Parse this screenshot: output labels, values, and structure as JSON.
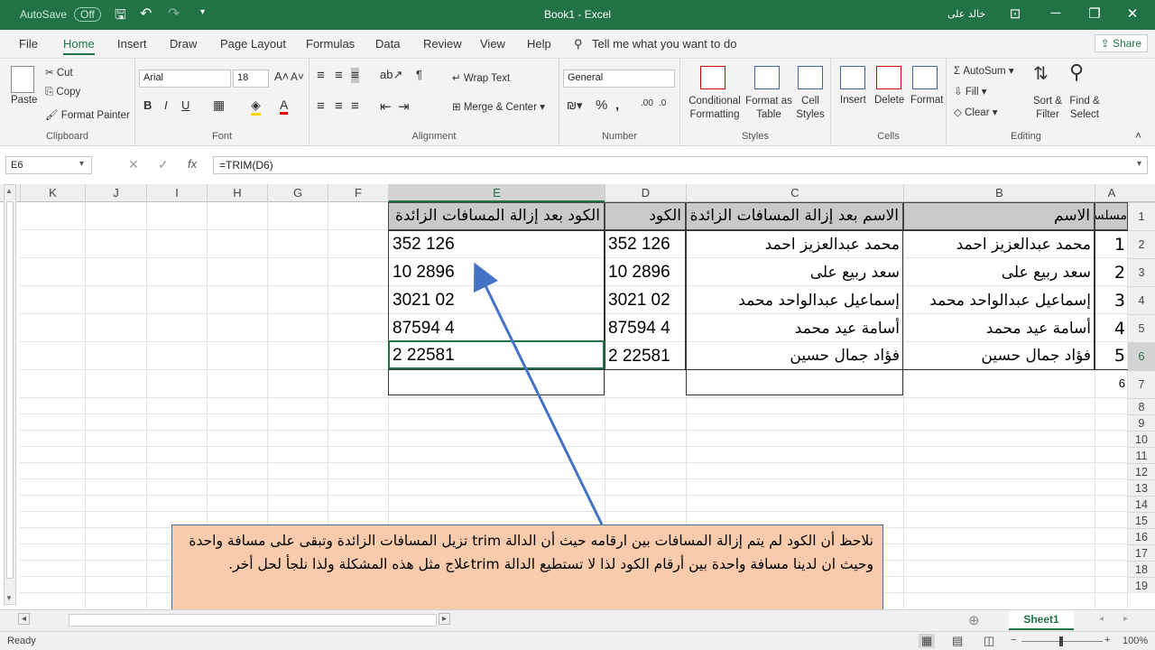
{
  "titlebar": {
    "autosave_label": "AutoSave",
    "autosave_state": "Off",
    "title": "Book1 - Excel",
    "user": "خالد على"
  },
  "menu": [
    "File",
    "Home",
    "Insert",
    "Draw",
    "Page Layout",
    "Formulas",
    "Data",
    "Review",
    "View",
    "Help"
  ],
  "tellme": "Tell me what you want to do",
  "share": "Share",
  "ribbon": {
    "clipboard": {
      "label": "Clipboard",
      "paste": "Paste",
      "cut": "Cut",
      "copy": "Copy",
      "format_painter": "Format Painter"
    },
    "font": {
      "label": "Font",
      "name": "Arial",
      "size": "18"
    },
    "alignment": {
      "label": "Alignment",
      "wrap": "Wrap Text",
      "merge": "Merge & Center"
    },
    "number": {
      "label": "Number",
      "format": "General"
    },
    "styles": {
      "label": "Styles",
      "conditional": "Conditional Formatting",
      "format_as": "Format as Table",
      "cell_styles": "Cell Styles"
    },
    "cells": {
      "label": "Cells",
      "insert": "Insert",
      "delete": "Delete",
      "format": "Format"
    },
    "editing": {
      "label": "Editing",
      "autosum": "AutoSum",
      "fill": "Fill",
      "clear": "Clear",
      "sort": "Sort & Filter",
      "find": "Find & Select"
    }
  },
  "namebox": "E6",
  "formula": "=TRIM(D6)",
  "columns": [
    "K",
    "J",
    "I",
    "H",
    "G",
    "F",
    "E",
    "D",
    "C",
    "B",
    "A"
  ],
  "rows": [
    "1",
    "2",
    "3",
    "4",
    "5",
    "6",
    "7",
    "8",
    "9",
    "10",
    "11",
    "12",
    "13",
    "14",
    "15",
    "16",
    "17",
    "18",
    "19"
  ],
  "table": {
    "headers": {
      "serial": "مسلسل",
      "name": "الاسم",
      "name_trim": "الاسم بعد إزالة المسافات الزائدة",
      "code": "الكود",
      "code_trim": "الكود بعد إزالة المسافات الزائدة"
    },
    "rows": [
      {
        "serial": "1",
        "name": "محمد  عبدالعزيز  احمد",
        "name_trim": "محمد عبدالعزيز احمد",
        "code": "352 126",
        "code_trim": "352 126"
      },
      {
        "serial": "2",
        "name": "سعد  ربيع   على",
        "name_trim": "سعد ربيع على",
        "code": "10 2896",
        "code_trim": "10 2896"
      },
      {
        "serial": "3",
        "name": "إسماعيل   عبدالواحد     محمد",
        "name_trim": "إسماعيل عبدالواحد محمد",
        "code": "3021 02",
        "code_trim": "3021 02"
      },
      {
        "serial": "4",
        "name": "أسامة  عيد  محمد",
        "name_trim": "أسامة عيد محمد",
        "code": "87594 4",
        "code_trim": "87594 4"
      },
      {
        "serial": "5",
        "name": "فؤاد  جمال  حسين",
        "name_trim": "فؤاد جمال حسين",
        "code": "2 22581",
        "code_trim": "2 22581"
      }
    ],
    "a7": "6"
  },
  "note": "نلاحظ أن الكود لم يتم إزالة المسافات بين ارقامه حيث أن الدالة trim تزيل المسافات الزائدة وتبقى على مسافة واحدة وحيث ان لدينا مسافة واحدة بين أرقام الكود لذا لا تستطيع الدالة trimعلاج مثل هذه المشكلة ولذا نلجأ لحل أخر.",
  "sheet_tab": "Sheet1",
  "status": {
    "ready": "Ready",
    "zoom": "100%"
  },
  "colors": {
    "accent": "#217346",
    "note_bg": "#f8cbad",
    "arrow": "#4472c4"
  }
}
